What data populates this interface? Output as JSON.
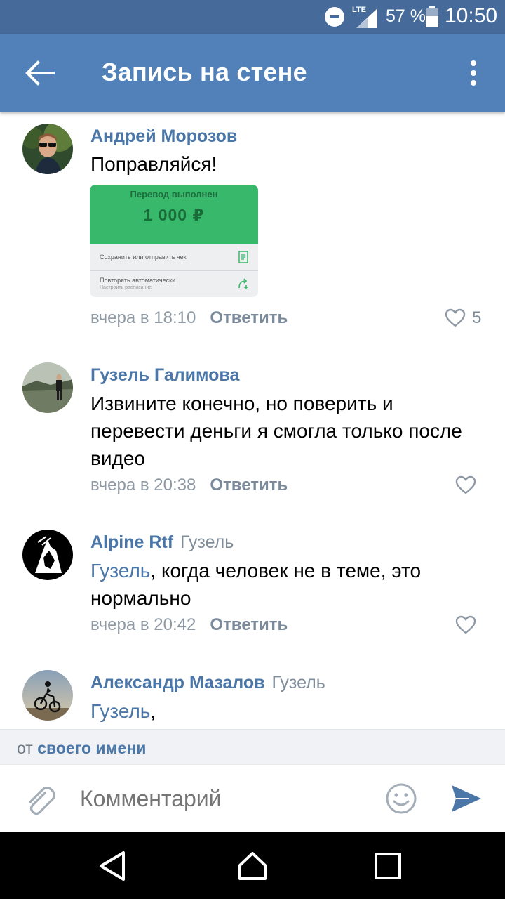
{
  "status_bar": {
    "network": "LTE",
    "battery": "57 %",
    "time": "10:50"
  },
  "toolbar": {
    "title": "Запись на стене"
  },
  "comments": [
    {
      "author": "Андрей Морозов",
      "reply_to": "",
      "mention": "",
      "text": "Поправляйся!",
      "time": "вчера в 18:10",
      "reply_label": "Ответить",
      "likes": "5",
      "attachment": {
        "title": "Перевод выполнен",
        "amount": "1 000 ₽",
        "action1": "Сохранить или отправить чек",
        "action2": "Повторять автоматически",
        "action2_sub": "Настроить расписание"
      }
    },
    {
      "author": "Гузель Галимова",
      "reply_to": "",
      "mention": "",
      "text": "Извините конечно, но поверить и перевести деньги я смогла только после видео",
      "time": "вчера в 20:38",
      "reply_label": "Ответить",
      "likes": ""
    },
    {
      "author": "Alpine Rtf",
      "reply_to": "Гузель",
      "mention": "Гузель",
      "text": ", когда человек не в теме, это нормально",
      "time": "вчера в 20:42",
      "reply_label": "Ответить",
      "likes": ""
    },
    {
      "author": "Александр Мазалов",
      "reply_to": "Гузель",
      "mention": "Гузель",
      "text": ",",
      "time": "",
      "reply_label": "",
      "likes": ""
    }
  ],
  "from_bar": {
    "prefix": "от",
    "link": "своего имени"
  },
  "input": {
    "placeholder": "Комментарий"
  },
  "colors": {
    "status_bar": "#466b9a",
    "toolbar": "#5181b8",
    "link": "#4a76a8",
    "transfer_green": "#38b86a",
    "send": "#4a76a8"
  },
  "icons": [
    "back-arrow-icon",
    "more-vert-icon",
    "heart-icon",
    "paperclip-icon",
    "emoji-icon",
    "send-icon",
    "nav-back-icon",
    "nav-home-icon",
    "nav-recents-icon"
  ]
}
